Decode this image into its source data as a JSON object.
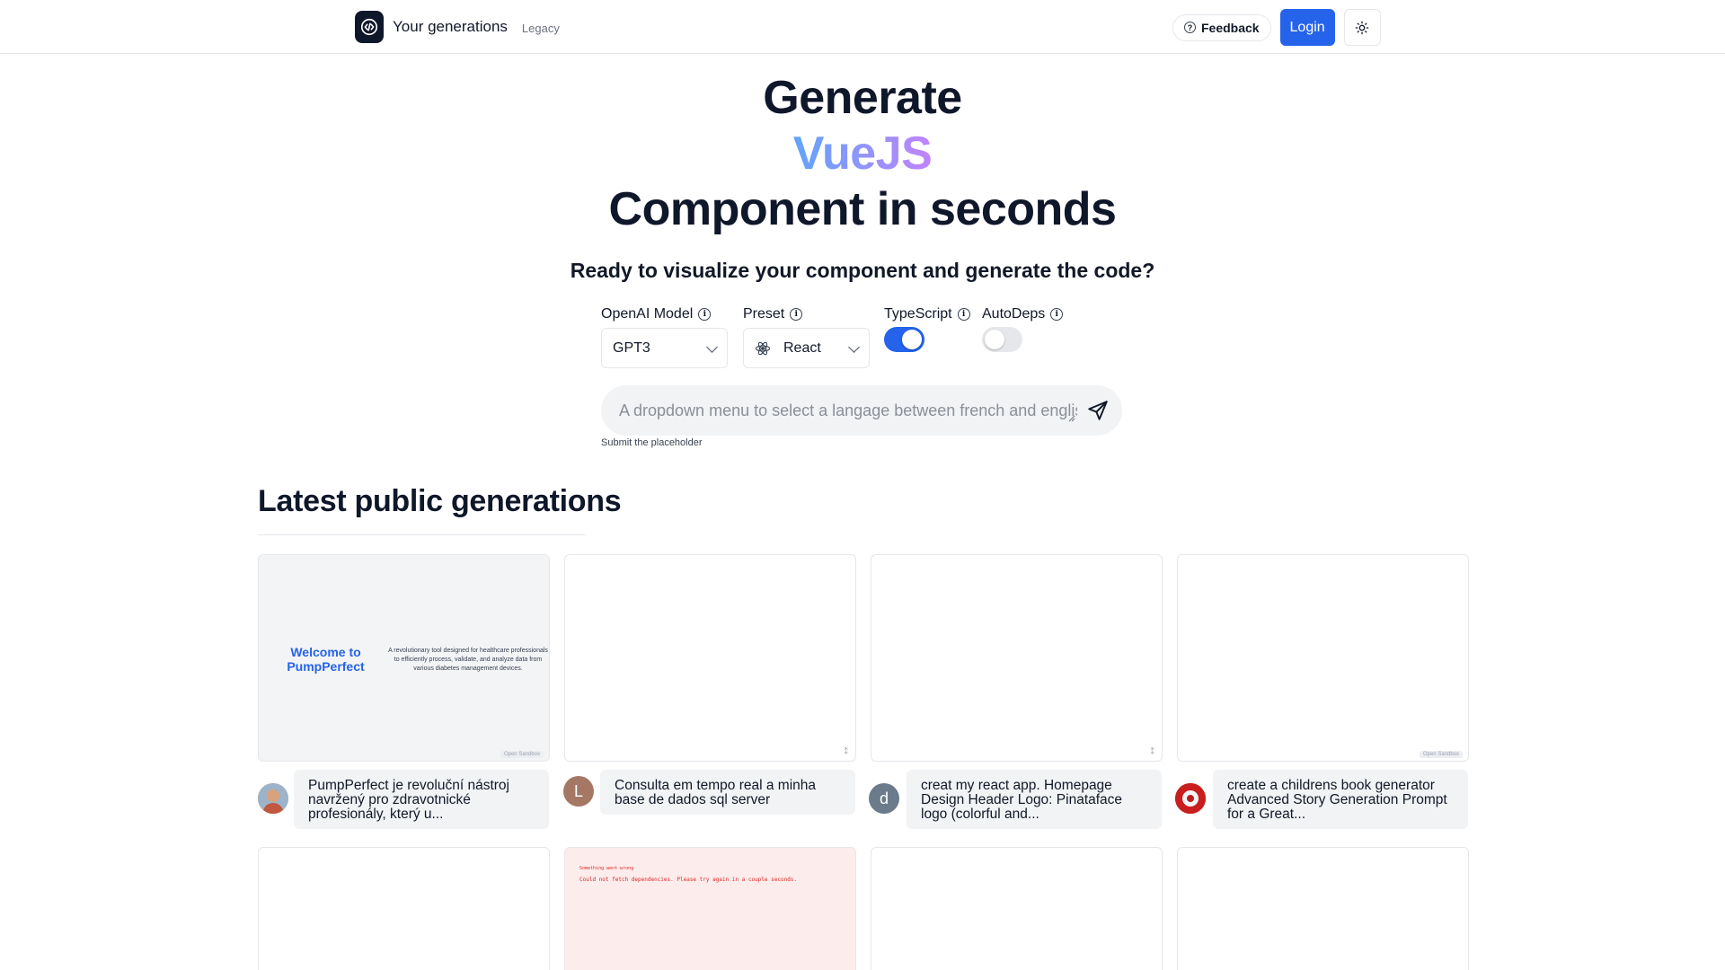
{
  "header": {
    "brand_title": "Your generations",
    "legacy_label": "Legacy",
    "feedback_label": "Feedback",
    "login_label": "Login"
  },
  "hero": {
    "line1": "Generate",
    "line2": "VueJS",
    "line3": "Component in seconds",
    "subtitle": "Ready to visualize your component and generate the code?"
  },
  "options": {
    "model_label": "OpenAI Model",
    "model_value": "GPT3",
    "preset_label": "Preset",
    "preset_value": "React",
    "typescript_label": "TypeScript",
    "typescript_on": true,
    "autodeps_label": "AutoDeps",
    "autodeps_on": false
  },
  "prompt": {
    "placeholder": "A dropdown menu to select a langage between french and english",
    "hint": "Submit the placeholder"
  },
  "section": {
    "title": "Latest public generations"
  },
  "cards": [
    {
      "preview_title": "Welcome to PumpPerfect",
      "preview_desc": "A revolutionary tool designed for healthcare professionals to efficiently process, validate, and analyze data from various diabetes management devices.",
      "sandbox_label": "Open Sandbox",
      "caption": "PumpPerfect je revoluční nástroj navržený pro zdravotnické profesionály, který u..."
    },
    {
      "avatar_letter": "L",
      "caption": "Consulta em tempo real a minha base de dados sql server"
    },
    {
      "avatar_letter": "d",
      "caption": "creat my react app. Homepage Design Header Logo: Pinataface logo (colorful and..."
    },
    {
      "sandbox_label": "Open Sandbox",
      "caption": "create a childrens book generator Advanced Story Generation Prompt for a Great..."
    }
  ],
  "row2": {
    "error_title": "Something went wrong",
    "error_message": "Could not fetch dependencies. Please try again in a couple seconds."
  },
  "colors": {
    "accent": "#2563eb",
    "gradient_start": "#60a5fa",
    "gradient_end": "#c084fc"
  }
}
